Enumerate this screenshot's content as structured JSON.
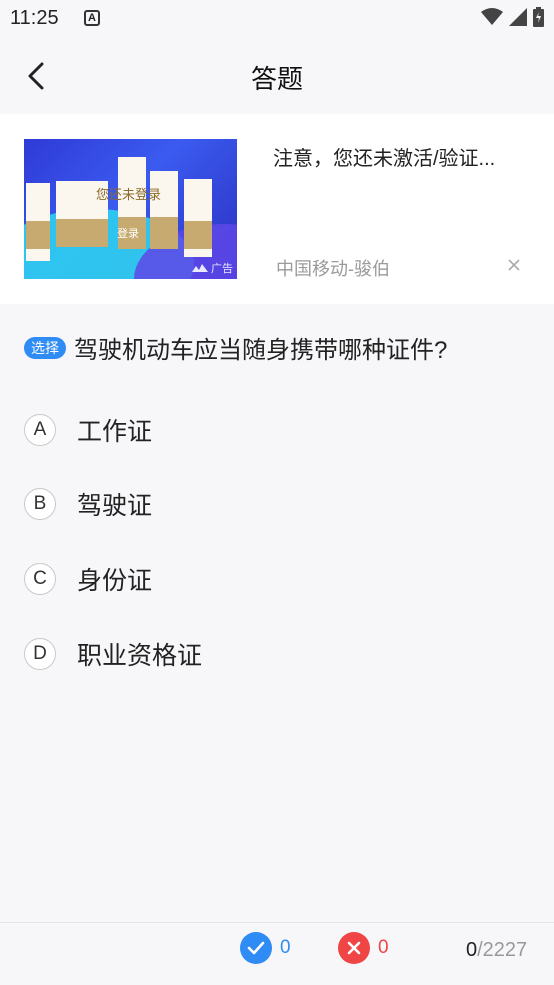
{
  "status": {
    "time": "11:25",
    "notif_icon": "A"
  },
  "nav": {
    "title": "答题"
  },
  "ad": {
    "title": "注意，您还未激活/验证...",
    "source": "中国移动-骏伯",
    "tag": "广告",
    "image_text": "您还未登录",
    "image_button": "登录"
  },
  "question": {
    "type_badge": "选择",
    "text": "驾驶机动车应当随身携带哪种证件?"
  },
  "options": [
    {
      "key": "A",
      "text": "工作证"
    },
    {
      "key": "B",
      "text": "驾驶证"
    },
    {
      "key": "C",
      "text": "身份证"
    },
    {
      "key": "D",
      "text": "职业资格证"
    }
  ],
  "footer": {
    "correct_count": "0",
    "wrong_count": "0",
    "progress_current": "0",
    "progress_total": "/2227"
  },
  "colors": {
    "accent": "#2f8cf5",
    "error": "#f04545"
  }
}
